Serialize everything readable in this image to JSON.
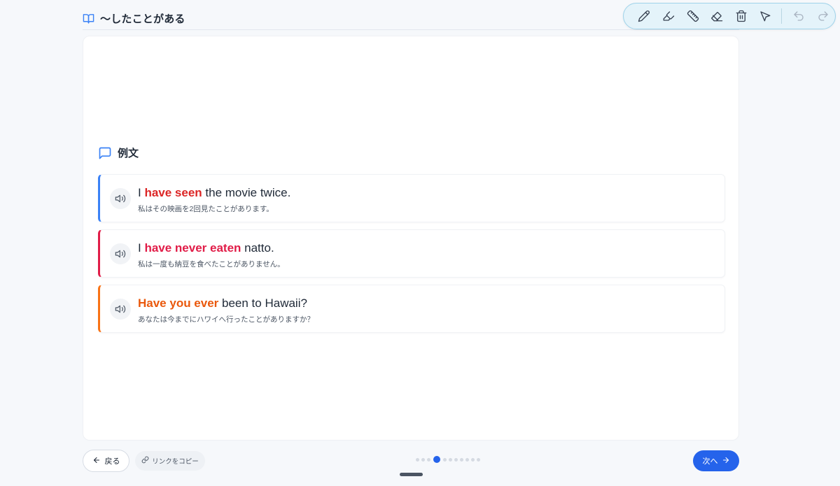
{
  "header": {
    "title": "〜したことがある",
    "icon": "book-open-icon"
  },
  "toolbar": {
    "tools": [
      "pencil-icon",
      "highlighter-icon",
      "ruler-icon",
      "eraser-icon",
      "trash-icon",
      "pointer-icon",
      "undo-icon",
      "redo-icon"
    ],
    "accent": "#9fd3ea"
  },
  "section": {
    "label": "例文",
    "icon": "message-square-icon"
  },
  "examples": [
    {
      "pre": "I ",
      "highlight": "have seen",
      "post": " the movie twice.",
      "translation": "私はその映画を2回見たことがあります。",
      "accent": "#3b82f6"
    },
    {
      "pre": "I ",
      "highlight": "have never eaten",
      "post": " natto.",
      "translation": "私は一度も納豆を食べたことがありません。",
      "accent": "#e11d48"
    },
    {
      "pre": "",
      "highlight": "Have you ever",
      "post": " been to Hawaii?",
      "translation": "あなたは今までにハワイへ行ったことがありますか？",
      "accent": "#f97316"
    }
  ],
  "nav": {
    "back_label": "戻る",
    "copy_label": "リンクをコピー",
    "next_label": "次へ",
    "page_count": 11,
    "current_page": 4,
    "accent": "#2563eb"
  }
}
